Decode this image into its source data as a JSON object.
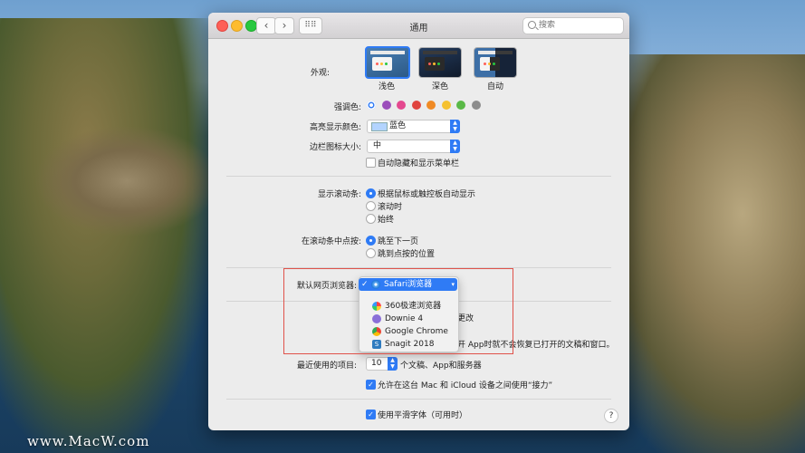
{
  "window": {
    "title": "通用",
    "search_placeholder": "搜索"
  },
  "appearance": {
    "label": "外观:",
    "options": [
      "浅色",
      "深色",
      "自动"
    ],
    "selected": "浅色"
  },
  "accent": {
    "label": "强调色:",
    "colors": [
      "#2f7bf5",
      "#9b4dbb",
      "#e4488f",
      "#e0443e",
      "#f08a24",
      "#f5c12e",
      "#5ab947",
      "#8d8d8d"
    ],
    "selected_index": 0
  },
  "highlight": {
    "label": "高亮显示颜色:",
    "value": "蓝色"
  },
  "sidebar_icon": {
    "label": "边栏图标大小:",
    "value": "中"
  },
  "auto_hide_menu": {
    "label": "自动隐藏和显示菜单栏",
    "checked": false
  },
  "scrollbars": {
    "label": "显示滚动条:",
    "options": [
      "根据鼠标或触控板自动显示",
      "滚动时",
      "始终"
    ],
    "selected_index": 0
  },
  "scroll_click": {
    "label": "在滚动条中点按:",
    "options": [
      "跳至下一页",
      "跳到点按的位置"
    ],
    "selected_index": 0
  },
  "default_browser": {
    "label": "默认网页浏览器:",
    "current": "Safari浏览器",
    "check": "✓",
    "menu_items": [
      "360极速浏览器",
      "Downie 4",
      "Google Chrome",
      "Snagit 2018"
    ]
  },
  "partial_text": {
    "close_changes": "更改",
    "close_windows": "开 App时就不会恢复已打开的文稿和窗口。"
  },
  "recent_items": {
    "label": "最近使用的项目:",
    "value": "10",
    "suffix": "个文稿、App和服务器"
  },
  "handoff": {
    "label": "允许在这台 Mac 和 iCloud 设备之间使用“接力”",
    "checked": true
  },
  "smooth_fonts": {
    "label": "使用平滑字体（可用时）",
    "checked": true
  },
  "help": "?",
  "watermark": "www.MacW.com"
}
